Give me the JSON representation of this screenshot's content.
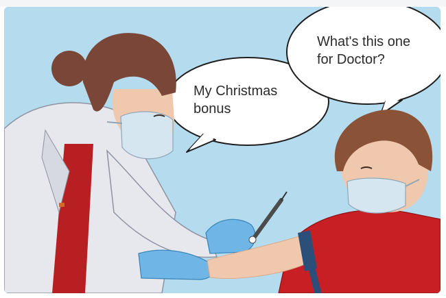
{
  "bubbles": {
    "doctor_text": "My Christmas\nbonus",
    "child_text": "What's this one\nfor Doctor?"
  },
  "colors": {
    "background": "#b5dcee",
    "coat": "#e7e8ee",
    "scrubs": "#b81f22",
    "hair_doctor": "#7a4638",
    "hair_child": "#8a5236",
    "skin": "#f0c8ad",
    "gloves": "#6fb6e6",
    "mask": "#d6e6f0",
    "shirt_child": "#c71f24",
    "tourniquet": "#2c4f7a"
  }
}
